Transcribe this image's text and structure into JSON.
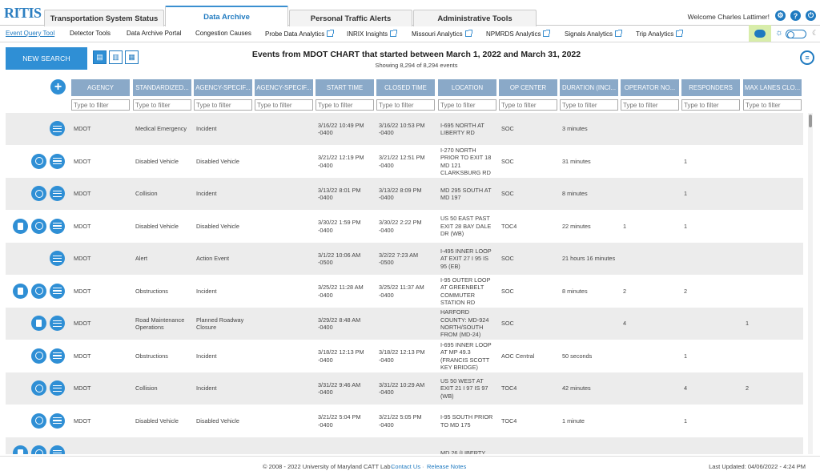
{
  "header": {
    "logo": "RITIS",
    "tabs": [
      {
        "label": "Transportation System Status",
        "active": false
      },
      {
        "label": "Data Archive",
        "active": true
      },
      {
        "label": "Personal Traffic Alerts",
        "active": false
      },
      {
        "label": "Administrative Tools",
        "active": false
      }
    ],
    "welcome": "Welcome Charles Lattimer!"
  },
  "nav": {
    "items": [
      {
        "label": "Event Query Tool",
        "external": false,
        "active": true
      },
      {
        "label": "Detector Tools",
        "external": false,
        "active": false
      },
      {
        "label": "Data Archive Portal",
        "external": false,
        "active": false
      },
      {
        "label": "Congestion Causes",
        "external": false,
        "active": false
      },
      {
        "label": "Probe Data Analytics",
        "external": true,
        "active": false
      },
      {
        "label": "INRIX Insights",
        "external": true,
        "active": false
      },
      {
        "label": "Missouri Analytics",
        "external": true,
        "active": false
      },
      {
        "label": "NPMRDS Analytics",
        "external": true,
        "active": false
      },
      {
        "label": "Signals Analytics",
        "external": true,
        "active": false
      },
      {
        "label": "Trip Analytics",
        "external": true,
        "active": false
      }
    ]
  },
  "toolbar": {
    "new_search_label": "NEW SEARCH",
    "title": "Events from MDOT CHART that started between March 1, 2022 and March 31, 2022",
    "subtitle": "Showing 8,294 of 8,294 events"
  },
  "table": {
    "columns": [
      "AGENCY",
      "STANDARDIZED...",
      "AGENCY-SPECIF...",
      "AGENCY-SPECIF...",
      "START TIME",
      "CLOSED TIME",
      "LOCATION",
      "OP CENTER",
      "DURATION (INCI...",
      "OPERATOR NO...",
      "RESPONDERS",
      "MAX LANES CLO..."
    ],
    "filter_placeholder": "Type to filter",
    "rows": [
      {
        "icons": [
          "list"
        ],
        "agency": "MDOT",
        "std": "Medical Emergency",
        "spec": "Incident",
        "spec2": "",
        "start": "3/16/22 10:49 PM -0400",
        "closed": "3/16/22 10:53 PM -0400",
        "location": "I-695 NORTH AT LIBERTY RD",
        "op": "SOC",
        "duration": "3 minutes",
        "operator": "",
        "responders": "",
        "lanes": ""
      },
      {
        "icons": [
          "clock",
          "list"
        ],
        "agency": "MDOT",
        "std": "Disabled Vehicle",
        "spec": "Disabled Vehicle",
        "spec2": "",
        "start": "3/21/22 12:19 PM -0400",
        "closed": "3/21/22 12:51 PM -0400",
        "location": "I-270 NORTH PRIOR TO EXIT 18 MD 121 CLARKSBURG RD",
        "op": "SOC",
        "duration": "31 minutes",
        "operator": "",
        "responders": "1",
        "lanes": ""
      },
      {
        "icons": [
          "clock",
          "list"
        ],
        "agency": "MDOT",
        "std": "Collision",
        "spec": "Incident",
        "spec2": "",
        "start": "3/13/22 8:01 PM -0400",
        "closed": "3/13/22 8:09 PM -0400",
        "location": "MD 295 SOUTH AT MD 197",
        "op": "SOC",
        "duration": "8 minutes",
        "operator": "",
        "responders": "1",
        "lanes": ""
      },
      {
        "icons": [
          "doc",
          "clock",
          "list"
        ],
        "agency": "MDOT",
        "std": "Disabled Vehicle",
        "spec": "Disabled Vehicle",
        "spec2": "",
        "start": "3/30/22 1:59 PM -0400",
        "closed": "3/30/22 2:22 PM -0400",
        "location": "US 50 EAST PAST EXIT 28 BAY DALE DR (WB)",
        "op": "TOC4",
        "duration": "22 minutes",
        "operator": "1",
        "responders": "1",
        "lanes": ""
      },
      {
        "icons": [
          "list"
        ],
        "agency": "MDOT",
        "std": "Alert",
        "spec": "Action Event",
        "spec2": "",
        "start": "3/1/22 10:06 AM -0500",
        "closed": "3/2/22 7:23 AM -0500",
        "location": "I-495 INNER LOOP AT EXIT 27 I 95 IS 95 (EB)",
        "op": "SOC",
        "duration": "21 hours 16 minutes",
        "operator": "",
        "responders": "",
        "lanes": ""
      },
      {
        "icons": [
          "doc",
          "clock",
          "list"
        ],
        "agency": "MDOT",
        "std": "Obstructions",
        "spec": "Incident",
        "spec2": "",
        "start": "3/25/22 11:28 AM -0400",
        "closed": "3/25/22 11:37 AM -0400",
        "location": "I-95 OUTER LOOP AT GREENBELT COMMUTER STATION RD",
        "op": "SOC",
        "duration": "8 minutes",
        "operator": "2",
        "responders": "2",
        "lanes": ""
      },
      {
        "icons": [
          "doc",
          "list"
        ],
        "agency": "MDOT",
        "std": "Road Maintenance Operations",
        "spec": "Planned Roadway Closure",
        "spec2": "",
        "start": "3/29/22 8:48 AM -0400",
        "closed": "",
        "location": "HARFORD COUNTY: MD-924 NORTH/SOUTH FROM (MD-24)",
        "op": "SOC",
        "duration": "",
        "operator": "4",
        "responders": "",
        "lanes": "1"
      },
      {
        "icons": [
          "clock",
          "list"
        ],
        "agency": "MDOT",
        "std": "Obstructions",
        "spec": "Incident",
        "spec2": "",
        "start": "3/18/22 12:13 PM -0400",
        "closed": "3/18/22 12:13 PM -0400",
        "location": "I-695 INNER LOOP AT MP 49.3 (FRANCIS SCOTT KEY BRIDGE)",
        "op": "AOC Central",
        "duration": "50 seconds",
        "operator": "",
        "responders": "1",
        "lanes": ""
      },
      {
        "icons": [
          "clock",
          "list"
        ],
        "agency": "MDOT",
        "std": "Collision",
        "spec": "Incident",
        "spec2": "",
        "start": "3/31/22 9:46 AM -0400",
        "closed": "3/31/22 10:29 AM -0400",
        "location": "US 50 WEST AT EXIT 21 I 97 IS 97 (WB)",
        "op": "TOC4",
        "duration": "42 minutes",
        "operator": "",
        "responders": "4",
        "lanes": "2"
      },
      {
        "icons": [
          "clock",
          "list"
        ],
        "agency": "MDOT",
        "std": "Disabled Vehicle",
        "spec": "Disabled Vehicle",
        "spec2": "",
        "start": "3/21/22 5:04 PM -0400",
        "closed": "3/21/22 5:05 PM -0400",
        "location": "I-95 SOUTH PRIOR TO MD 175",
        "op": "TOC4",
        "duration": "1 minute",
        "operator": "",
        "responders": "1",
        "lanes": ""
      },
      {
        "icons": [
          "doc",
          "clock",
          "list"
        ],
        "agency": "",
        "std": "",
        "spec": "",
        "spec2": "",
        "start": "",
        "closed": "",
        "location": "MD 26 (LIBERTY",
        "op": "",
        "duration": "",
        "operator": "",
        "responders": "",
        "lanes": ""
      }
    ]
  },
  "footer": {
    "copyright": "© 2008 - 2022 University of Maryland CATT Lab ·",
    "contact": "Contact Us",
    "release": "Release Notes",
    "updated": "Last Updated: 04/06/2022 - 4:24 PM"
  },
  "colors": {
    "accent": "#2f8fd5",
    "header_bg": "#8aa9c8",
    "row_alt": "#ececec"
  }
}
